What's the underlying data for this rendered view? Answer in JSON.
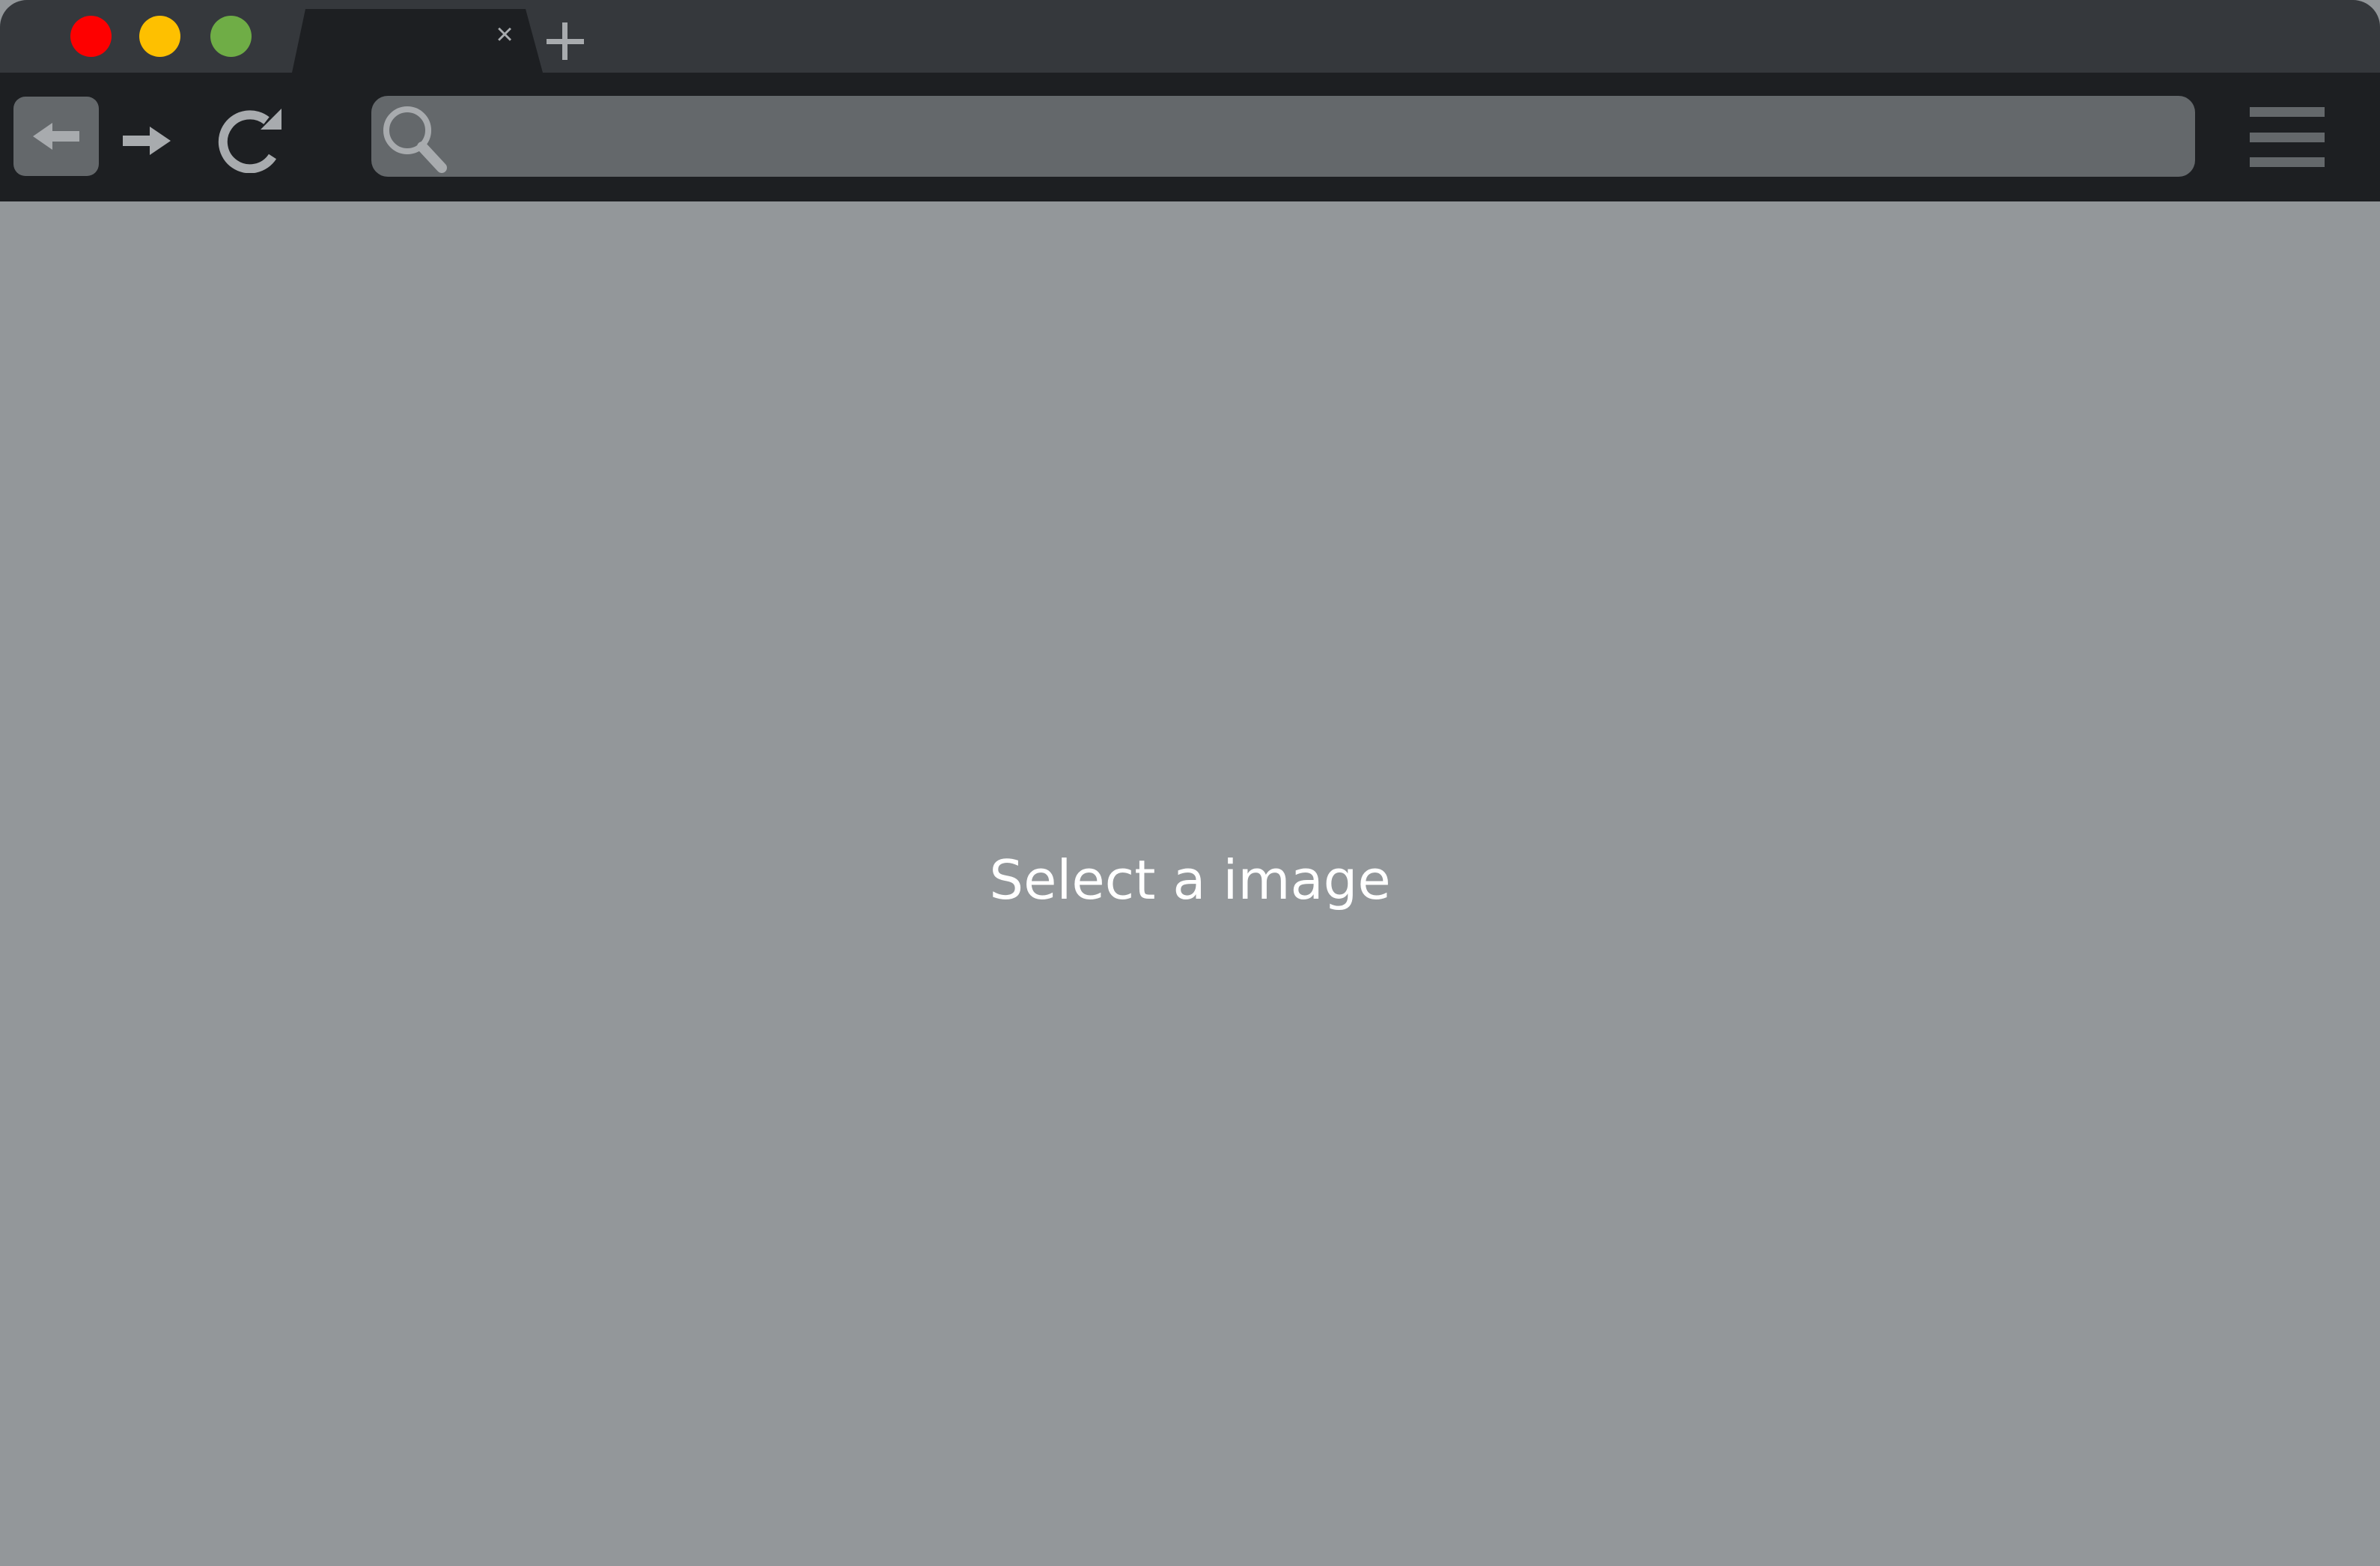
{
  "window": {
    "controls": {
      "close_color": "#fe0000",
      "minimize_color": "#fec000",
      "maximize_color": "#6fad46"
    }
  },
  "tabs": [
    {
      "title": "",
      "close_glyph": "×"
    }
  ],
  "toolbar": {
    "back_icon": "arrow-left-icon",
    "forward_icon": "arrow-right-icon",
    "reload_icon": "reload-icon",
    "menu_icon": "hamburger-menu-icon"
  },
  "address_bar": {
    "icon": "search-icon",
    "value": "",
    "placeholder": ""
  },
  "content": {
    "message": "Select a image"
  },
  "colors": {
    "titlebar": "#35383c",
    "toolbar": "#1d1f22",
    "address_bar": "#64686b",
    "content_bg": "#93979a",
    "icon": "#a8abae"
  }
}
